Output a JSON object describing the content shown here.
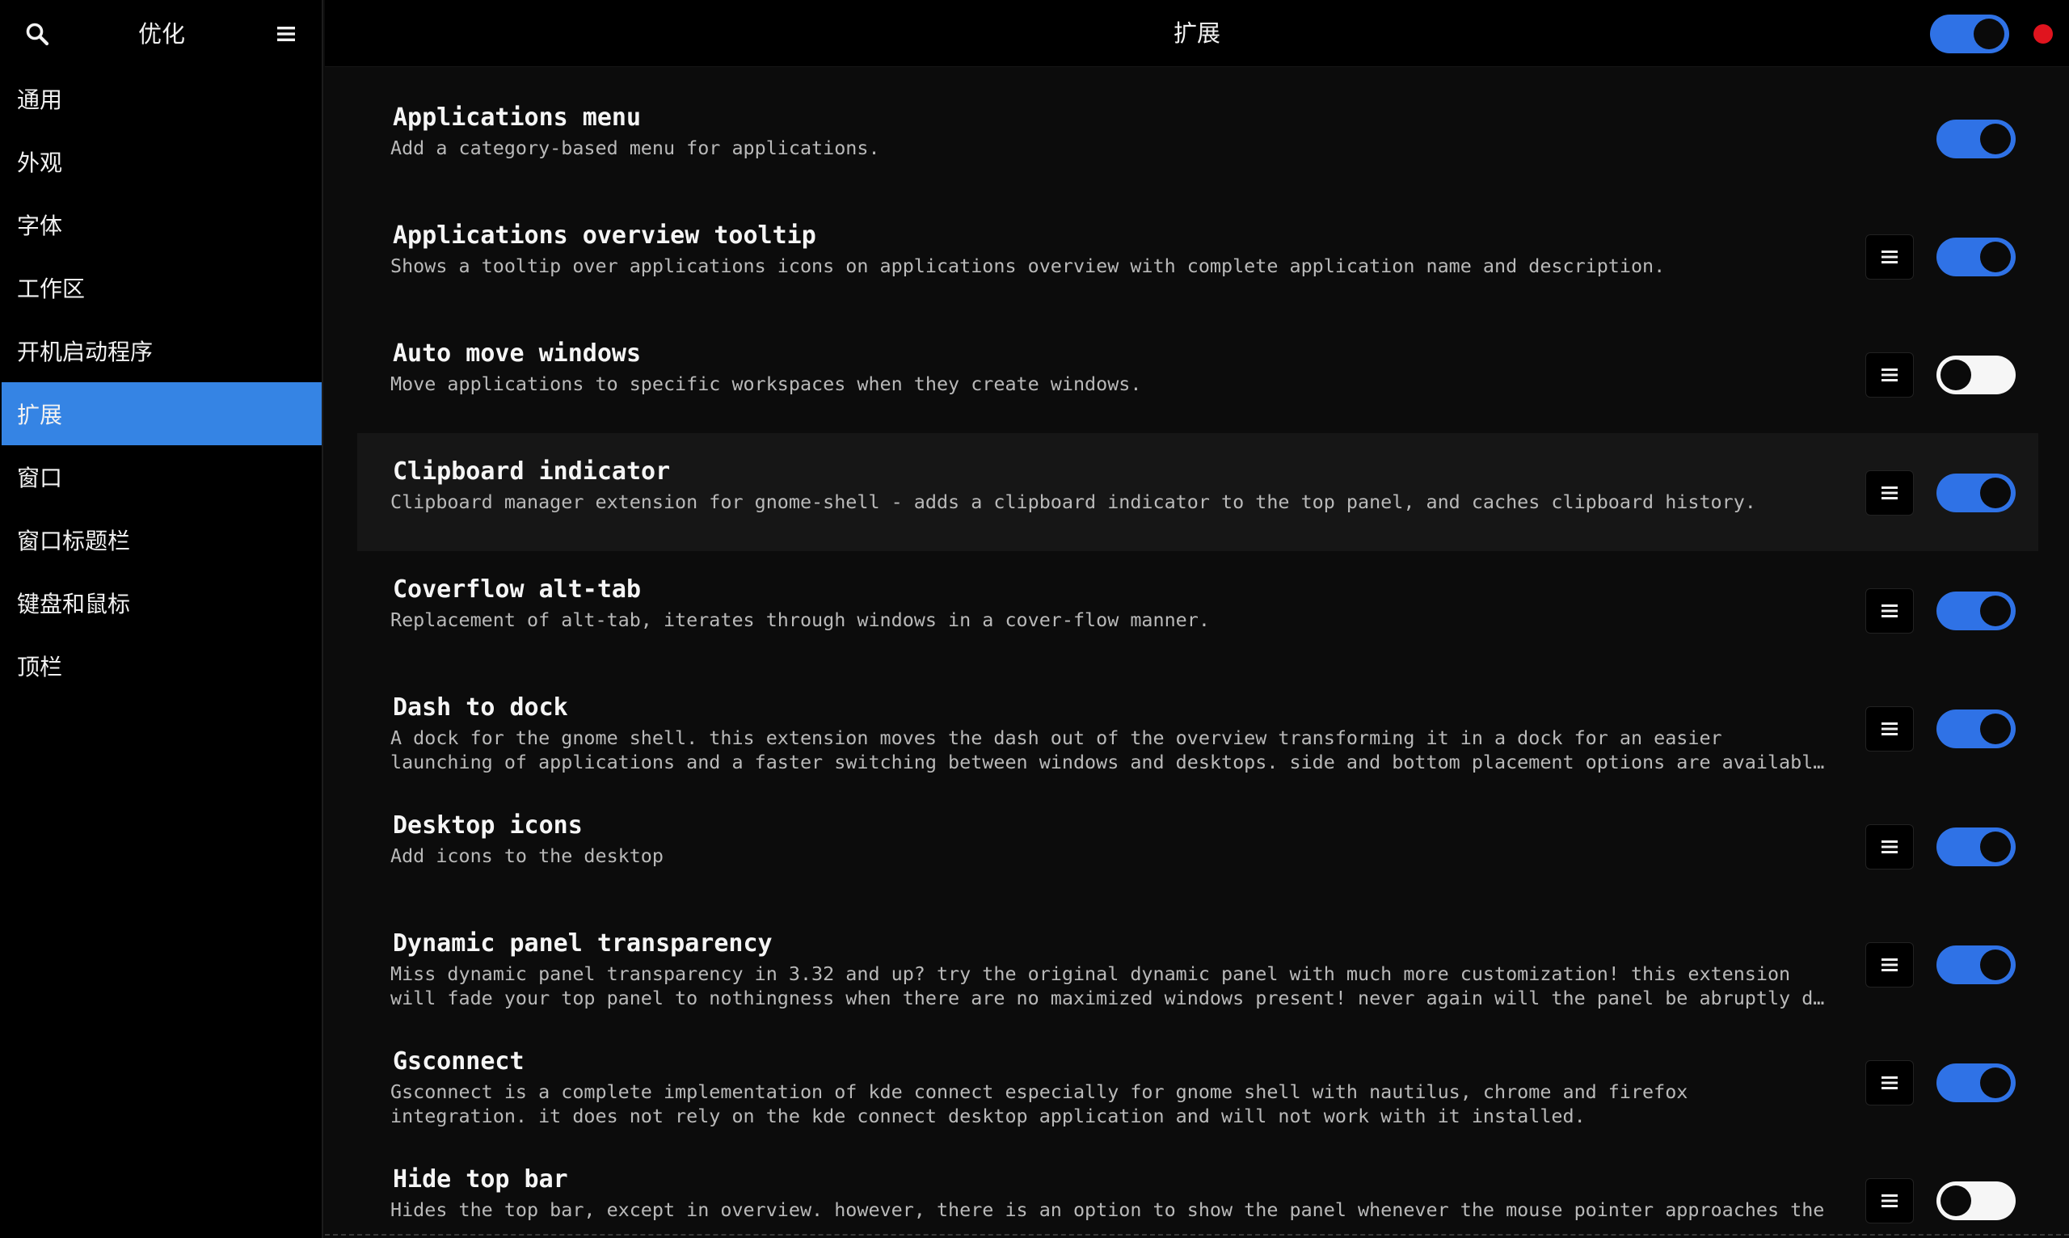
{
  "sidebar": {
    "title": "优化",
    "search_icon": "search-icon",
    "menu_icon": "hamburger-menu-icon",
    "items": [
      {
        "label": "通用"
      },
      {
        "label": "外观"
      },
      {
        "label": "字体"
      },
      {
        "label": "工作区"
      },
      {
        "label": "开机启动程序"
      },
      {
        "label": "扩展",
        "active": true
      },
      {
        "label": "窗口"
      },
      {
        "label": "窗口标题栏"
      },
      {
        "label": "键盘和鼠标"
      },
      {
        "label": "顶栏"
      }
    ]
  },
  "header": {
    "title": "扩展",
    "global_toggle_on": true,
    "close_color": "#e0141e"
  },
  "colors": {
    "accent": "#3584e4",
    "toggle_on": "#2f72e6",
    "toggle_off": "#f6f6f6",
    "background": "#0c0c0c"
  },
  "extensions": [
    {
      "name": "Applications menu",
      "description": [
        "Add a category-based menu for applications."
      ],
      "has_settings": false,
      "enabled": true
    },
    {
      "name": "Applications overview tooltip",
      "description": [
        "Shows a tooltip over applications icons on applications overview with complete application name and description."
      ],
      "has_settings": true,
      "enabled": true
    },
    {
      "name": "Auto move windows",
      "description": [
        "Move applications to specific workspaces when they create windows."
      ],
      "has_settings": true,
      "enabled": false
    },
    {
      "name": "Clipboard indicator",
      "description": [
        "Clipboard manager extension for gnome-shell - adds a clipboard indicator to the top panel, and caches clipboard history."
      ],
      "has_settings": true,
      "enabled": true,
      "highlighted": true
    },
    {
      "name": "Coverflow alt-tab",
      "description": [
        "Replacement of alt-tab, iterates through windows in a cover-flow manner."
      ],
      "has_settings": true,
      "enabled": true
    },
    {
      "name": "Dash to dock",
      "description": [
        "A dock for the gnome shell. this extension moves the dash out of the overview transforming it in a dock for an easier",
        "launching of applications and a faster switching between windows and desktops. side and bottom placement options are available."
      ],
      "has_settings": true,
      "enabled": true
    },
    {
      "name": "Desktop icons",
      "description": [
        "Add icons to the desktop"
      ],
      "has_settings": true,
      "enabled": true
    },
    {
      "name": "Dynamic panel transparency",
      "description": [
        "Miss dynamic panel transparency in 3.32 and up? try the original dynamic panel with much more customization! this extension",
        "will fade your top panel to nothingness when there are no maximized windows present! never again will the panel be abruptly da…"
      ],
      "has_settings": true,
      "enabled": true
    },
    {
      "name": "Gsconnect",
      "description": [
        "Gsconnect is a complete implementation of kde connect especially for gnome shell with nautilus, chrome and firefox",
        "integration. it does not rely on the kde connect desktop application and will not work with it installed."
      ],
      "has_settings": true,
      "enabled": true
    },
    {
      "name": "Hide top bar",
      "description": [
        "Hides the top bar, except in overview. however, there is an option to show the panel whenever the mouse pointer approaches the"
      ],
      "has_settings": true,
      "enabled": false
    }
  ]
}
